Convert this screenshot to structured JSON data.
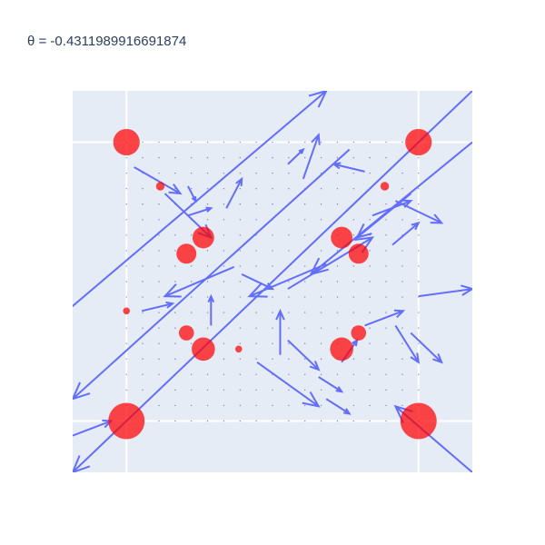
{
  "chart_data": {
    "type": "quiver+scatter",
    "title": "θ =  -0.4311989916691874",
    "xlabel": "",
    "ylabel": "",
    "xlim": [
      -1.3,
      1.3
    ],
    "ylim": [
      -1.3,
      1.3
    ],
    "grid": true,
    "legend": "none",
    "colors": {
      "plot_background": "#e5ecf6",
      "grid": "#ffffff",
      "arrows": "#636efa",
      "markers": "#ff0000"
    },
    "marker_series": {
      "name": "",
      "points": [
        {
          "x": -0.95,
          "y": 0.95,
          "size": 0.7
        },
        {
          "x": 0.95,
          "y": 0.95,
          "size": 0.7
        },
        {
          "x": -0.95,
          "y": -0.95,
          "size": 1.0
        },
        {
          "x": 0.95,
          "y": -0.95,
          "size": 1.0
        },
        {
          "x": -0.45,
          "y": 0.3,
          "size": 0.55
        },
        {
          "x": 0.45,
          "y": 0.3,
          "size": 0.55
        },
        {
          "x": -0.56,
          "y": 0.19,
          "size": 0.5
        },
        {
          "x": 0.56,
          "y": 0.19,
          "size": 0.5
        },
        {
          "x": -0.56,
          "y": -0.35,
          "size": 0.35
        },
        {
          "x": 0.56,
          "y": -0.35,
          "size": 0.35
        },
        {
          "x": -0.45,
          "y": -0.46,
          "size": 0.6
        },
        {
          "x": 0.45,
          "y": -0.46,
          "size": 0.6
        },
        {
          "x": -0.73,
          "y": 0.65,
          "size": 0.15
        },
        {
          "x": 0.73,
          "y": 0.65,
          "size": 0.15
        },
        {
          "x": -0.22,
          "y": -0.46,
          "size": 0.1
        },
        {
          "x": -0.95,
          "y": -0.2,
          "size": 0.1
        }
      ]
    },
    "arrow_series": {
      "name": "",
      "arrows": [
        {
          "x0": -1.35,
          "y0": -1.05,
          "x1": -1.55,
          "y1": -0.7
        },
        {
          "x0": -1.45,
          "y0": -0.3,
          "x1": 0.35,
          "y1": 1.3
        },
        {
          "x0": -0.7,
          "y0": 0.6,
          "x1": -0.4,
          "y1": 0.3
        },
        {
          "x0": -0.9,
          "y0": 0.78,
          "x1": -0.6,
          "y1": 0.6
        },
        {
          "x0": 0.5,
          "y0": 0.9,
          "x1": -1.3,
          "y1": -0.8
        },
        {
          "x0": 1.3,
          "y0": 1.3,
          "x1": -1.3,
          "y1": -1.3
        },
        {
          "x0": 0.9,
          "y0": 0.6,
          "x1": 0.55,
          "y1": 0.3
        },
        {
          "x0": 0.2,
          "y0": 0.7,
          "x1": 0.3,
          "y1": 1.0
        },
        {
          "x0": 1.3,
          "y0": 0.95,
          "x1": 0.25,
          "y1": 0.05
        },
        {
          "x0": -0.3,
          "y0": 0.5,
          "x1": -0.2,
          "y1": 0.7
        },
        {
          "x0": -0.25,
          "y0": 0.1,
          "x1": -0.7,
          "y1": -0.1
        },
        {
          "x0": 0.35,
          "y0": 0.12,
          "x1": -0.15,
          "y1": -0.1
        },
        {
          "x0": 0.1,
          "y0": -0.05,
          "x1": 0.65,
          "y1": 0.3
        },
        {
          "x0": 0.6,
          "y0": 0.75,
          "x1": 0.4,
          "y1": 0.8
        },
        {
          "x0": 0.8,
          "y0": 0.55,
          "x1": 1.1,
          "y1": 0.4
        },
        {
          "x0": -0.4,
          "y0": -0.3,
          "x1": -0.4,
          "y1": -0.1
        },
        {
          "x0": -0.1,
          "y0": -0.55,
          "x1": 0.3,
          "y1": -0.85
        },
        {
          "x0": 0.1,
          "y0": -0.4,
          "x1": 0.3,
          "y1": -0.6
        },
        {
          "x0": 0.05,
          "y0": -0.5,
          "x1": 0.05,
          "y1": -0.2
        },
        {
          "x0": 0.45,
          "y0": -0.55,
          "x1": 0.55,
          "y1": -0.4
        },
        {
          "x0": 0.6,
          "y0": -0.3,
          "x1": 0.85,
          "y1": -0.2
        },
        {
          "x0": 0.9,
          "y0": -0.35,
          "x1": 1.1,
          "y1": -0.55
        },
        {
          "x0": 0.95,
          "y0": -0.1,
          "x1": 1.3,
          "y1": -0.05
        },
        {
          "x0": 0.8,
          "y0": -0.3,
          "x1": 0.95,
          "y1": -0.55
        },
        {
          "x0": -0.85,
          "y0": -0.2,
          "x1": -0.65,
          "y1": -0.15
        },
        {
          "x0": 0.3,
          "y0": -0.65,
          "x1": 0.45,
          "y1": -0.75
        },
        {
          "x0": 0.35,
          "y0": -0.8,
          "x1": 0.5,
          "y1": -0.9
        },
        {
          "x0": 1.3,
          "y0": -1.3,
          "x1": 0.8,
          "y1": -0.85
        },
        {
          "x0": -1.3,
          "y0": -1.05,
          "x1": -1.05,
          "y1": -0.95
        },
        {
          "x0": -0.55,
          "y0": 0.45,
          "x1": -0.4,
          "y1": 0.5
        },
        {
          "x0": 0.65,
          "y0": 0.45,
          "x1": 0.9,
          "y1": 0.55
        },
        {
          "x0": 0.1,
          "y0": 0.8,
          "x1": 0.2,
          "y1": 0.9
        },
        {
          "x0": -0.2,
          "y0": 0.05,
          "x1": 0.0,
          "y1": -0.05
        },
        {
          "x0": -0.55,
          "y0": 0.65,
          "x1": -0.5,
          "y1": 0.55
        },
        {
          "x0": 0.78,
          "y0": 0.25,
          "x1": 0.95,
          "y1": 0.4
        }
      ]
    }
  }
}
